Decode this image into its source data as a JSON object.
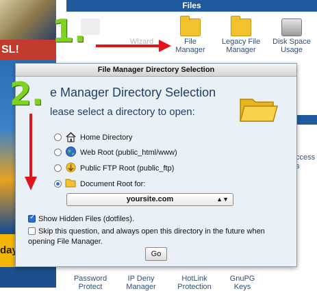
{
  "background": {
    "left_banner_text": "SL!",
    "left_bottom_text": "day",
    "files_section": {
      "title": "Files",
      "icons": [
        {
          "label": "",
          "icon": "backup-icon",
          "faded": true
        },
        {
          "label": "Wizard",
          "icon": "wizard-icon",
          "faded": true
        },
        {
          "label_line1": "File",
          "label_line2": "Manager",
          "icon": "folder-icon"
        },
        {
          "label_line1": "Legacy File",
          "label_line2": "Manager",
          "icon": "folder-icon"
        },
        {
          "label_line1": "Disk Space",
          "label_line2": "Usage",
          "icon": "disk-icon"
        }
      ]
    },
    "right_fragment_line1": "ccess",
    "right_fragment_line2": "s",
    "bottom_icons": [
      {
        "label_line1": "Password",
        "label_line2": "Protect"
      },
      {
        "label_line1": "IP Deny",
        "label_line2": "Manager"
      },
      {
        "label_line1": "HotLink",
        "label_line2": "Protection"
      },
      {
        "label_line1": "GnuPG",
        "label_line2": "Keys"
      }
    ]
  },
  "dialog": {
    "title": "File Manager Directory Selection",
    "heading": "e Manager Directory Selection",
    "subheading": "lease select a directory to open:",
    "options": [
      {
        "label": "Home Directory",
        "selected": false,
        "icon": "home-icon"
      },
      {
        "label": "Web Root (public_html/www)",
        "selected": false,
        "icon": "globe-icon"
      },
      {
        "label": "Public FTP Root (public_ftp)",
        "selected": false,
        "icon": "ftp-icon"
      },
      {
        "label": "Document Root for:",
        "selected": true,
        "icon": "folder-icon"
      }
    ],
    "domain_select": {
      "value": "yoursite.com",
      "arrow": "▲▼"
    },
    "show_hidden": {
      "label": "Show Hidden Files (dotfiles).",
      "checked": true
    },
    "skip_question": {
      "label_line1": "Skip this question, and always open this directory in the future when",
      "label_line2": "opening File Manager.",
      "checked": false
    },
    "go_button": "Go"
  },
  "annotations": {
    "step1": "1.",
    "step2": "2.",
    "arrow_color": "#e0141b",
    "number_color": "#7ed321"
  }
}
